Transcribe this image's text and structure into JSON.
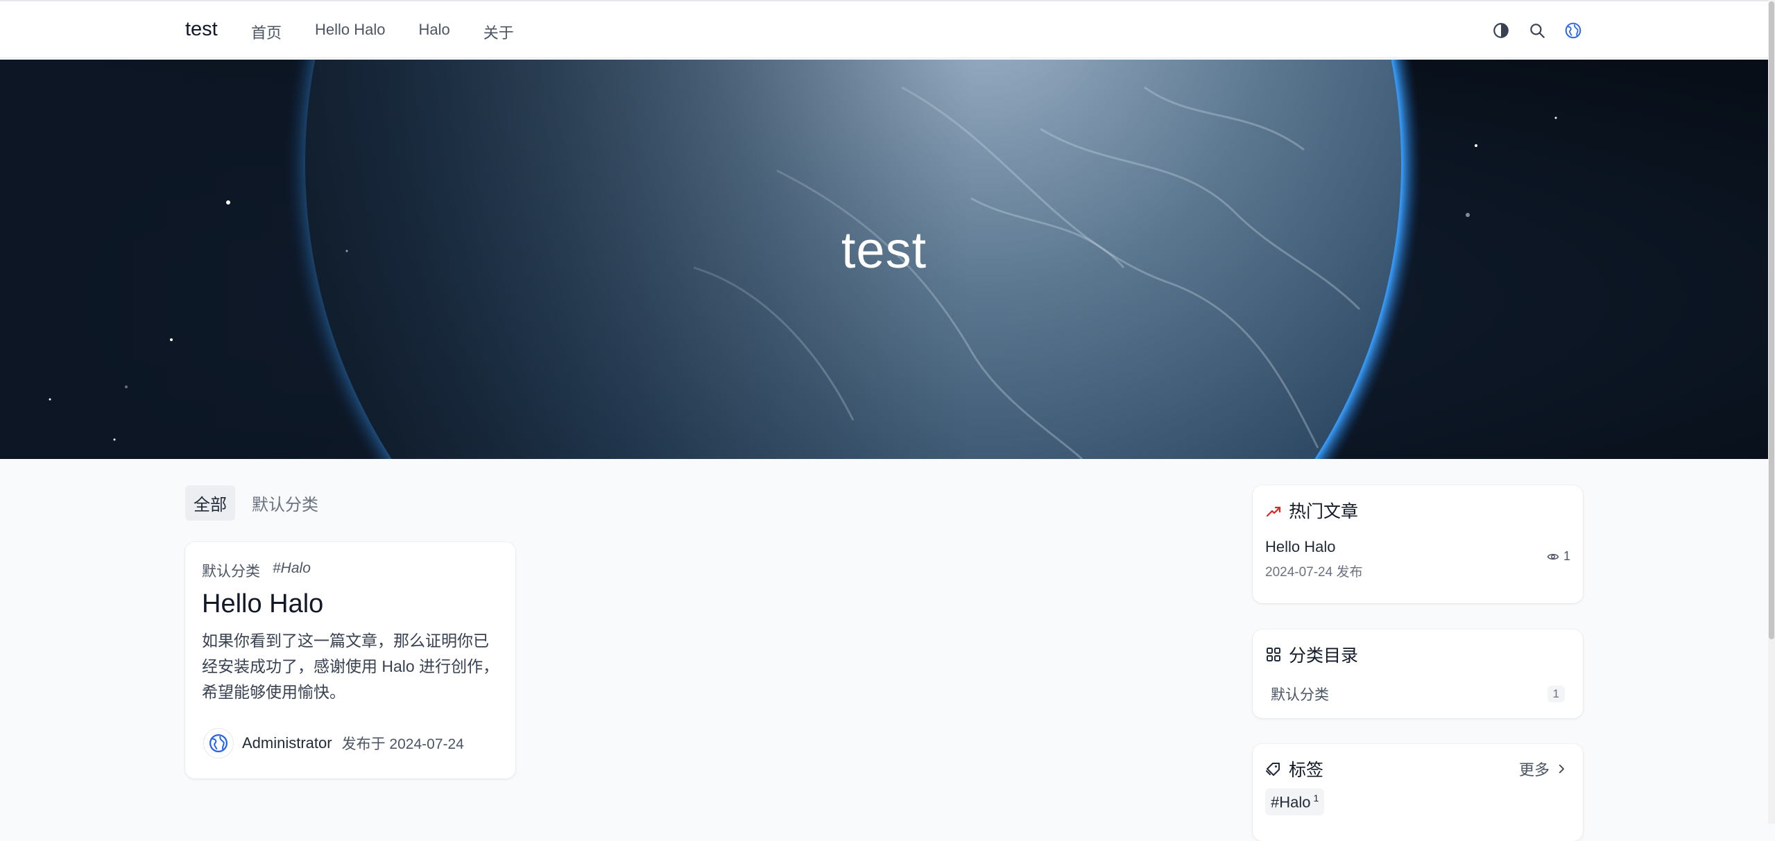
{
  "header": {
    "brand": "test",
    "nav": [
      "首页",
      "Hello Halo",
      "Halo",
      "关于"
    ],
    "icons": [
      "theme-toggle-icon",
      "search-icon",
      "globe-icon"
    ]
  },
  "hero": {
    "title": "test"
  },
  "tabs": {
    "items": [
      "全部",
      "默认分类"
    ],
    "active": "全部"
  },
  "post": {
    "category": "默认分类",
    "tag": "#Halo",
    "title": "Hello Halo",
    "excerpt": "如果你看到了这一篇文章，那么证明你已经安装成功了，感谢使用 Halo 进行创作，希望能够使用愉快。",
    "author": "Administrator",
    "published": "发布于 2024-07-24"
  },
  "sidebar": {
    "hot": {
      "title": "热门文章",
      "items": [
        {
          "title": "Hello Halo",
          "date": "2024-07-24 发布",
          "views": "1"
        }
      ]
    },
    "categories": {
      "title": "分类目录",
      "items": [
        {
          "name": "默认分类",
          "count": "1"
        }
      ]
    },
    "tags": {
      "title": "标签",
      "more": "更多",
      "items": [
        {
          "name": "#Halo",
          "count": "1"
        }
      ]
    }
  },
  "colors": {
    "accent": "#2563eb",
    "hot_icon": "#dc2626",
    "page_bg": "#f8fafc"
  }
}
